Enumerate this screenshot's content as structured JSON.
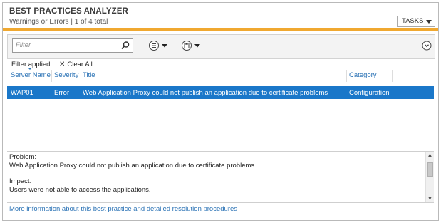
{
  "header": {
    "title": "BEST PRACTICES ANALYZER",
    "subtitle": "Warnings or Errors | 1 of 4 total",
    "tasks_label": "TASKS"
  },
  "toolbar": {
    "filter_placeholder": "Filter"
  },
  "filter_status": {
    "applied_label": "Filter applied.",
    "clear_x": "✕",
    "clear_all_label": "Clear All"
  },
  "table": {
    "columns": [
      "Server Name",
      "Severity",
      "Title",
      "Category"
    ],
    "rows": [
      {
        "server_name": "WAP01",
        "severity": "Error",
        "title": "Web Application Proxy could not publish an application due to certificate problems",
        "category": "Configuration",
        "selected": true
      }
    ]
  },
  "details": {
    "problem_heading": "Problem:",
    "problem_text": "Web Application Proxy could not publish an application due to certificate problems.",
    "impact_heading": "Impact:",
    "impact_text": "Users were not able to access the applications."
  },
  "more_info_link": "More information about this best practice and detailed resolution procedures",
  "colors": {
    "accent_bar": "#f0a830",
    "selection": "#1a77c9",
    "link": "#2a72b5"
  }
}
